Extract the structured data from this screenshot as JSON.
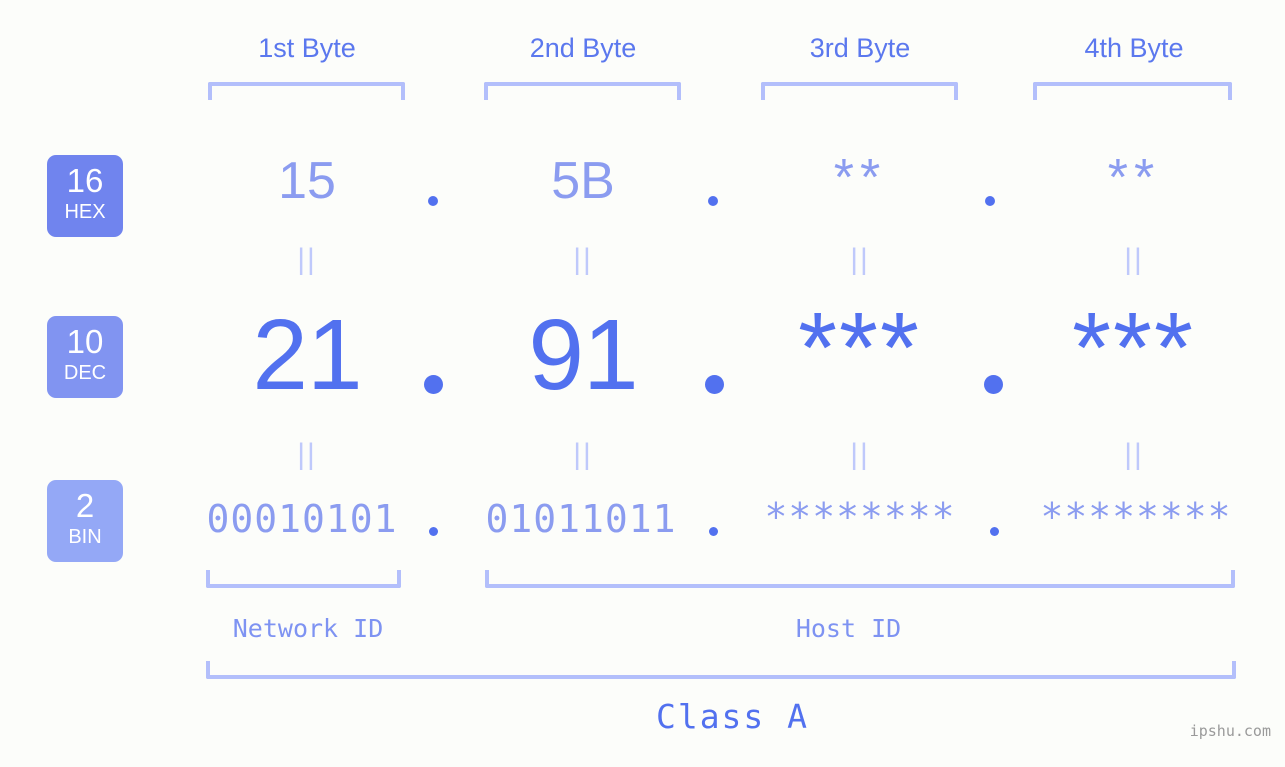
{
  "meta": {
    "watermark": "ipshu.com",
    "background_color": "#fcfdfa",
    "accent_color": "#5271ef",
    "light_accent_color": "#8b9cf0",
    "bracket_color": "#b3bffb"
  },
  "headers": {
    "byte1": "1st Byte",
    "byte2": "2nd Byte",
    "byte3": "3rd Byte",
    "byte4": "4th Byte"
  },
  "bases": {
    "hex": {
      "number": "16",
      "abbr": "HEX",
      "color": "#7084ee"
    },
    "dec": {
      "number": "10",
      "abbr": "DEC",
      "color": "#8194f1"
    },
    "bin": {
      "number": "2",
      "abbr": "BIN",
      "color": "#94a8f6"
    }
  },
  "rows": {
    "hex": {
      "values": [
        "15",
        "5B",
        "**",
        "**"
      ],
      "separators": [
        ".",
        ".",
        "."
      ]
    },
    "dec": {
      "values": [
        "21",
        "91",
        "***",
        "***"
      ],
      "separators": [
        ".",
        ".",
        "."
      ]
    },
    "bin": {
      "values": [
        "00010101",
        "01011011",
        "********",
        "********"
      ],
      "separators": [
        ".",
        ".",
        "."
      ]
    }
  },
  "equals": {
    "symbol": "||"
  },
  "segments": {
    "network_id": "Network ID",
    "host_id": "Host ID",
    "class": "Class A"
  }
}
